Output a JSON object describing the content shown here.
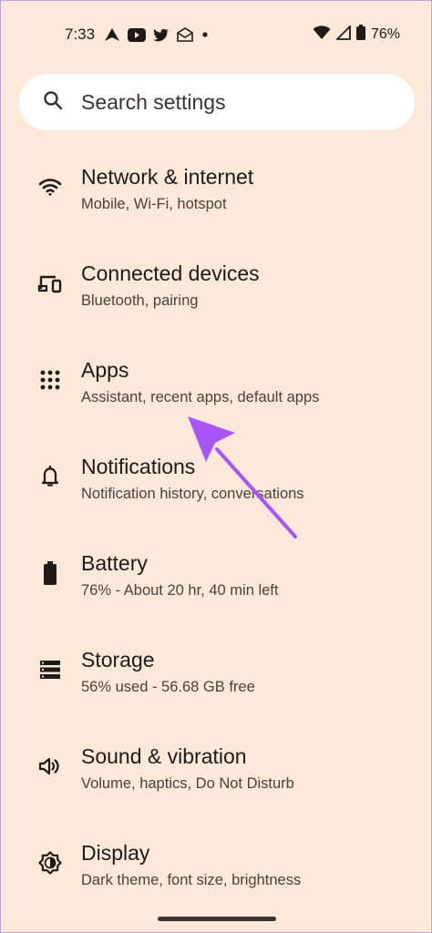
{
  "status_bar": {
    "time": "7:33",
    "left_icons": [
      "navigation-arrow-icon",
      "youtube-icon",
      "twitter-icon",
      "mail-icon",
      "dot-icon"
    ],
    "right_icons": [
      "wifi-icon",
      "signal-icon",
      "battery-icon"
    ],
    "battery_percent": "76%"
  },
  "search": {
    "placeholder": "Search settings"
  },
  "settings": [
    {
      "title": "Network & internet",
      "subtitle": "Mobile, Wi-Fi, hotspot",
      "icon": "wifi-icon"
    },
    {
      "title": "Connected devices",
      "subtitle": "Bluetooth, pairing",
      "icon": "devices-icon"
    },
    {
      "title": "Apps",
      "subtitle": "Assistant, recent apps, default apps",
      "icon": "apps-grid-icon"
    },
    {
      "title": "Notifications",
      "subtitle": "Notification history, conversations",
      "icon": "bell-icon"
    },
    {
      "title": "Battery",
      "subtitle": "76% - About 20 hr, 40 min left",
      "icon": "battery-icon"
    },
    {
      "title": "Storage",
      "subtitle": "56% used - 56.68 GB free",
      "icon": "storage-icon"
    },
    {
      "title": "Sound & vibration",
      "subtitle": "Volume, haptics, Do Not Disturb",
      "icon": "speaker-icon"
    },
    {
      "title": "Display",
      "subtitle": "Dark theme, font size, brightness",
      "icon": "brightness-icon"
    }
  ],
  "colors": {
    "background": "#fde9d9",
    "search_bg": "#ffffff",
    "text_primary": "#1f1a17",
    "text_secondary": "#4a413d",
    "annotation_arrow": "#a855f7"
  }
}
